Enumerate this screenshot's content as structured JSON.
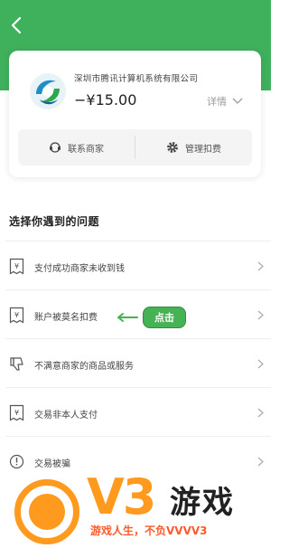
{
  "header": {
    "back_icon": "chevron-left-icon"
  },
  "card": {
    "merchant_name": "深圳市腾讯计算机系统有限公司",
    "amount": "−¥15.00",
    "details_label": "详情",
    "actions": [
      {
        "label": "联系商家",
        "icon": "contact-merchant-icon"
      },
      {
        "label": "管理扣费",
        "icon": "gear-icon"
      }
    ]
  },
  "section": {
    "title": "选择你遇到的问题"
  },
  "issues": [
    {
      "label": "支付成功商家未收到钱",
      "icon": "receipt-icon"
    },
    {
      "label": "账户被莫名扣费",
      "icon": "receipt-icon"
    },
    {
      "label": "不满意商家的商品或服务",
      "icon": "thumbs-down-icon"
    },
    {
      "label": "交易非本人支付",
      "icon": "receipt-icon"
    },
    {
      "label": "交易被骗",
      "icon": "alert-icon"
    }
  ],
  "annotation": {
    "label": "点击"
  },
  "watermark": {
    "brand": "V3",
    "brand_suffix": "游戏",
    "slogan": "游戏人生，不负VVVV3"
  },
  "colors": {
    "accent": "#3fb05c",
    "watermark": "#ff9a1f"
  }
}
